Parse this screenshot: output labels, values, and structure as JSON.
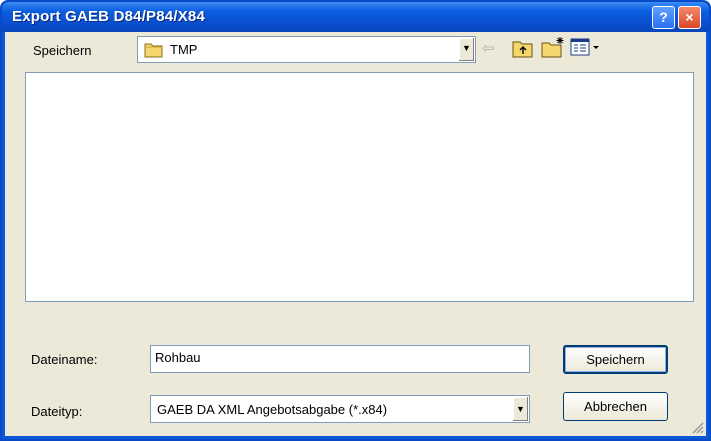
{
  "window": {
    "title": "Export GAEB D84/P84/X84",
    "help_label": "?",
    "close_label": "×"
  },
  "location": {
    "label": "Speichern",
    "folder_icon": "folder-icon",
    "value": "TMP"
  },
  "toolbar": {
    "back_icon": "back-arrow-icon",
    "up_icon": "up-folder-icon",
    "new_folder_icon": "new-folder-icon",
    "view_icon": "view-menu-icon"
  },
  "filename": {
    "label": "Dateiname:",
    "value": "Rohbau"
  },
  "filetype": {
    "label": "Dateityp:",
    "value": "GAEB DA XML  Angebotsabgabe (*.x84)"
  },
  "buttons": {
    "save": "Speichern",
    "cancel": "Abbrechen"
  },
  "colors": {
    "title_bar": "#0a58d8",
    "client_bg": "#ece9d8",
    "close": "#d8462a"
  }
}
